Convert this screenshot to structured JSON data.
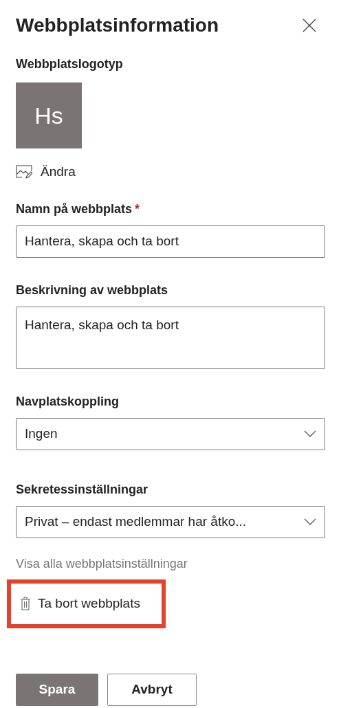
{
  "title": "Webbplatsinformation",
  "logo": {
    "label": "Webbplatslogotyp",
    "initials": "Hs",
    "change": "Ändra"
  },
  "fields": [
    {
      "kind": "text",
      "label": "Namn på webbplats",
      "required_mark": "*",
      "value": "Hantera, skapa och ta bort"
    },
    {
      "kind": "textarea",
      "label": "Beskrivning av webbplats",
      "value": "Hantera, skapa och ta bort"
    },
    {
      "kind": "select",
      "label": "Navplatskoppling",
      "value": "Ingen"
    },
    {
      "kind": "select",
      "label": "Sekretessinställningar",
      "value": "Privat – endast medlemmar har åtko..."
    }
  ],
  "settings_link": "Visa alla webbplatsinställningar",
  "delete": {
    "label": "Ta bort webbplats",
    "highlighted": true
  },
  "buttons": [
    {
      "kind": "primary",
      "label": "Spara"
    },
    {
      "kind": "secondary",
      "label": "Avbryt"
    }
  ]
}
